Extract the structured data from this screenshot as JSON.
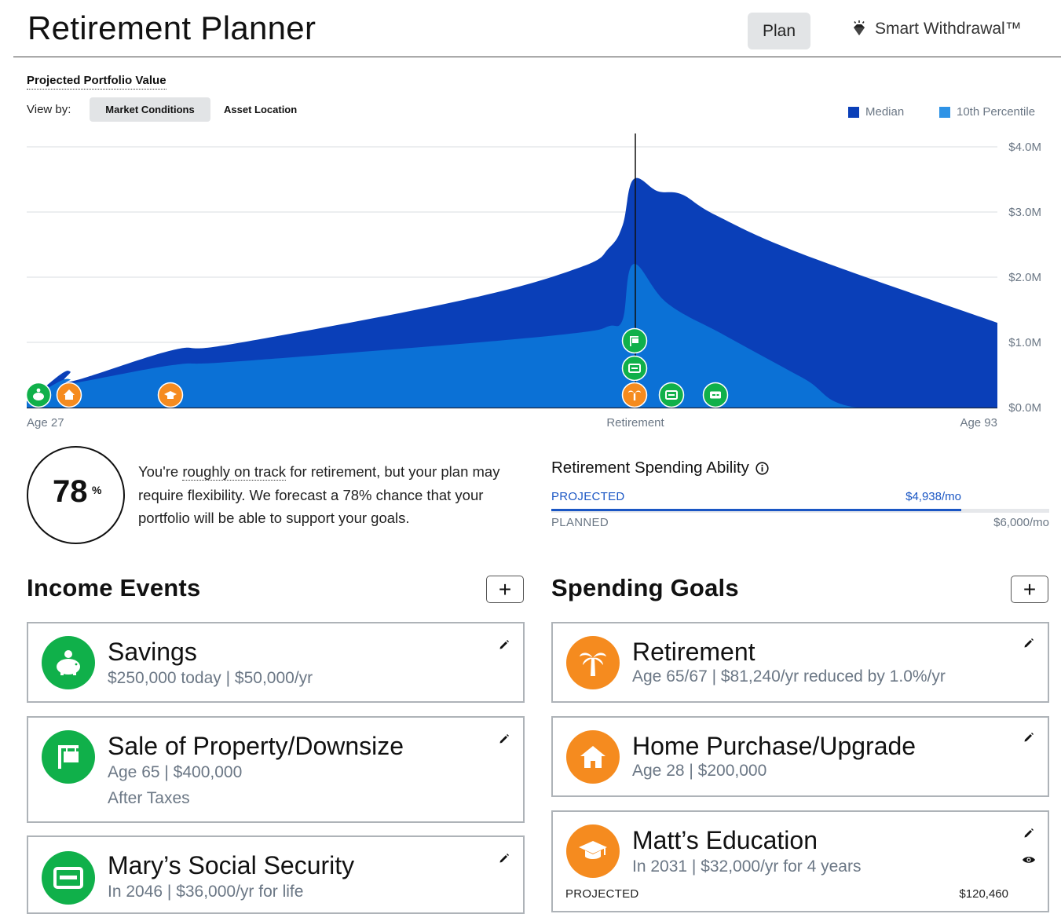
{
  "header": {
    "title": "Retirement Planner",
    "plan_label": "Plan",
    "smart_withdrawal_label": "Smart Withdrawal™"
  },
  "chart_panel": {
    "title": "Projected Portfolio Value",
    "view_by_label": "View by:",
    "tabs": [
      {
        "label": "Market Conditions",
        "active": true
      },
      {
        "label": "Asset Location",
        "active": false
      }
    ],
    "legend": [
      {
        "label": "Median",
        "color": "#0a3fb8"
      },
      {
        "label": "10th Percentile",
        "color": "#2e93e6"
      }
    ],
    "x_labels": {
      "start": "Age 27",
      "middle": "Retirement",
      "end": "Age 93"
    },
    "y_ticks": [
      "$4.0M",
      "$3.0M",
      "$2.0M",
      "$1.0M",
      "$0.0M"
    ],
    "event_markers": [
      {
        "icon": "piggy-bank-icon",
        "color": "#10b04a"
      },
      {
        "icon": "house-icon",
        "color": "#f58b1f"
      },
      {
        "icon": "graduation-cap-icon",
        "color": "#f58b1f"
      },
      {
        "icon": "palm-tree-icon",
        "color": "#f58b1f"
      },
      {
        "icon": "for-sale-sign-icon",
        "color": "#10b04a"
      },
      {
        "icon": "id-card-icon",
        "color": "#10b04a"
      },
      {
        "icon": "id-card-icon",
        "color": "#10b04a"
      },
      {
        "icon": "pension-card-icon",
        "color": "#10b04a"
      }
    ]
  },
  "chart_data": {
    "type": "area",
    "title": "Projected Portfolio Value",
    "xlabel": "",
    "ylabel": "",
    "x": [
      "Age 27",
      "Retirement",
      "Age 93"
    ],
    "ylim": [
      0,
      4.0
    ],
    "y_unit": "$M",
    "grid": true,
    "legend_position": "top-right",
    "series": [
      {
        "name": "Median",
        "points": [
          [
            0,
            0.07
          ],
          [
            0.034,
            0.5
          ],
          [
            0.045,
            0.55
          ],
          [
            0.046,
            0.4
          ],
          [
            0.15,
            0.88
          ],
          [
            0.21,
            0.97
          ],
          [
            0.45,
            1.65
          ],
          [
            0.57,
            2.15
          ],
          [
            0.6,
            2.45
          ],
          [
            0.614,
            2.8
          ],
          [
            0.625,
            3.5
          ],
          [
            0.65,
            3.32
          ],
          [
            0.675,
            3.27
          ],
          [
            0.71,
            2.95
          ],
          [
            0.8,
            2.35
          ],
          [
            1,
            1.3
          ]
        ]
      },
      {
        "name": "10th Percentile",
        "points": [
          [
            0,
            0.1
          ],
          [
            0.034,
            0.4
          ],
          [
            0.045,
            0.43
          ],
          [
            0.046,
            0.37
          ],
          [
            0.15,
            0.65
          ],
          [
            0.21,
            0.7
          ],
          [
            0.45,
            0.98
          ],
          [
            0.57,
            1.15
          ],
          [
            0.6,
            1.25
          ],
          [
            0.614,
            1.35
          ],
          [
            0.625,
            2.2
          ],
          [
            0.66,
            1.6
          ],
          [
            0.72,
            1.1
          ],
          [
            0.8,
            0.45
          ],
          [
            0.855,
            0.0
          ],
          [
            1,
            0.0
          ]
        ]
      }
    ]
  },
  "score": {
    "value": "78",
    "suffix": "%",
    "text_before": "You're ",
    "text_highlight": "roughly on track",
    "text_after": " for retirement, but your plan may require flexibility. We forecast a 78% chance that your portfolio will be able to support your goals."
  },
  "spending_ability": {
    "title": "Retirement Spending Ability",
    "projected_label": "PROJECTED",
    "projected_value": "$4,938/mo",
    "planned_label": "PLANNED",
    "planned_value": "$6,000/mo",
    "progress_fraction": 0.823
  },
  "income_events": {
    "title": "Income Events",
    "add_label": "+",
    "items": [
      {
        "icon": "piggy-bank-icon",
        "title": "Savings",
        "subtitle": "$250,000 today | $50,000/yr",
        "extra": ""
      },
      {
        "icon": "for-sale-sign-icon",
        "title": "Sale of Property/Downsize",
        "subtitle": "Age 65 | $400,000",
        "extra": "After Taxes"
      },
      {
        "icon": "id-card-icon",
        "title": "Mary’s Social Security",
        "subtitle": "In 2046 | $36,000/yr for life",
        "extra": ""
      }
    ]
  },
  "spending_goals": {
    "title": "Spending Goals",
    "add_label": "+",
    "items": [
      {
        "icon": "palm-tree-icon",
        "title": "Retirement",
        "subtitle": "Age 65/67 | $81,240/yr reduced by 1.0%/yr"
      },
      {
        "icon": "house-icon",
        "title": "Home Purchase/Upgrade",
        "subtitle": "Age 28 | $200,000"
      },
      {
        "icon": "graduation-cap-icon",
        "title": "Matt’s Education",
        "subtitle": "In 2031 | $32,000/yr for 4 years",
        "projected_label": "PROJECTED",
        "projected_value": "$120,460"
      }
    ]
  }
}
